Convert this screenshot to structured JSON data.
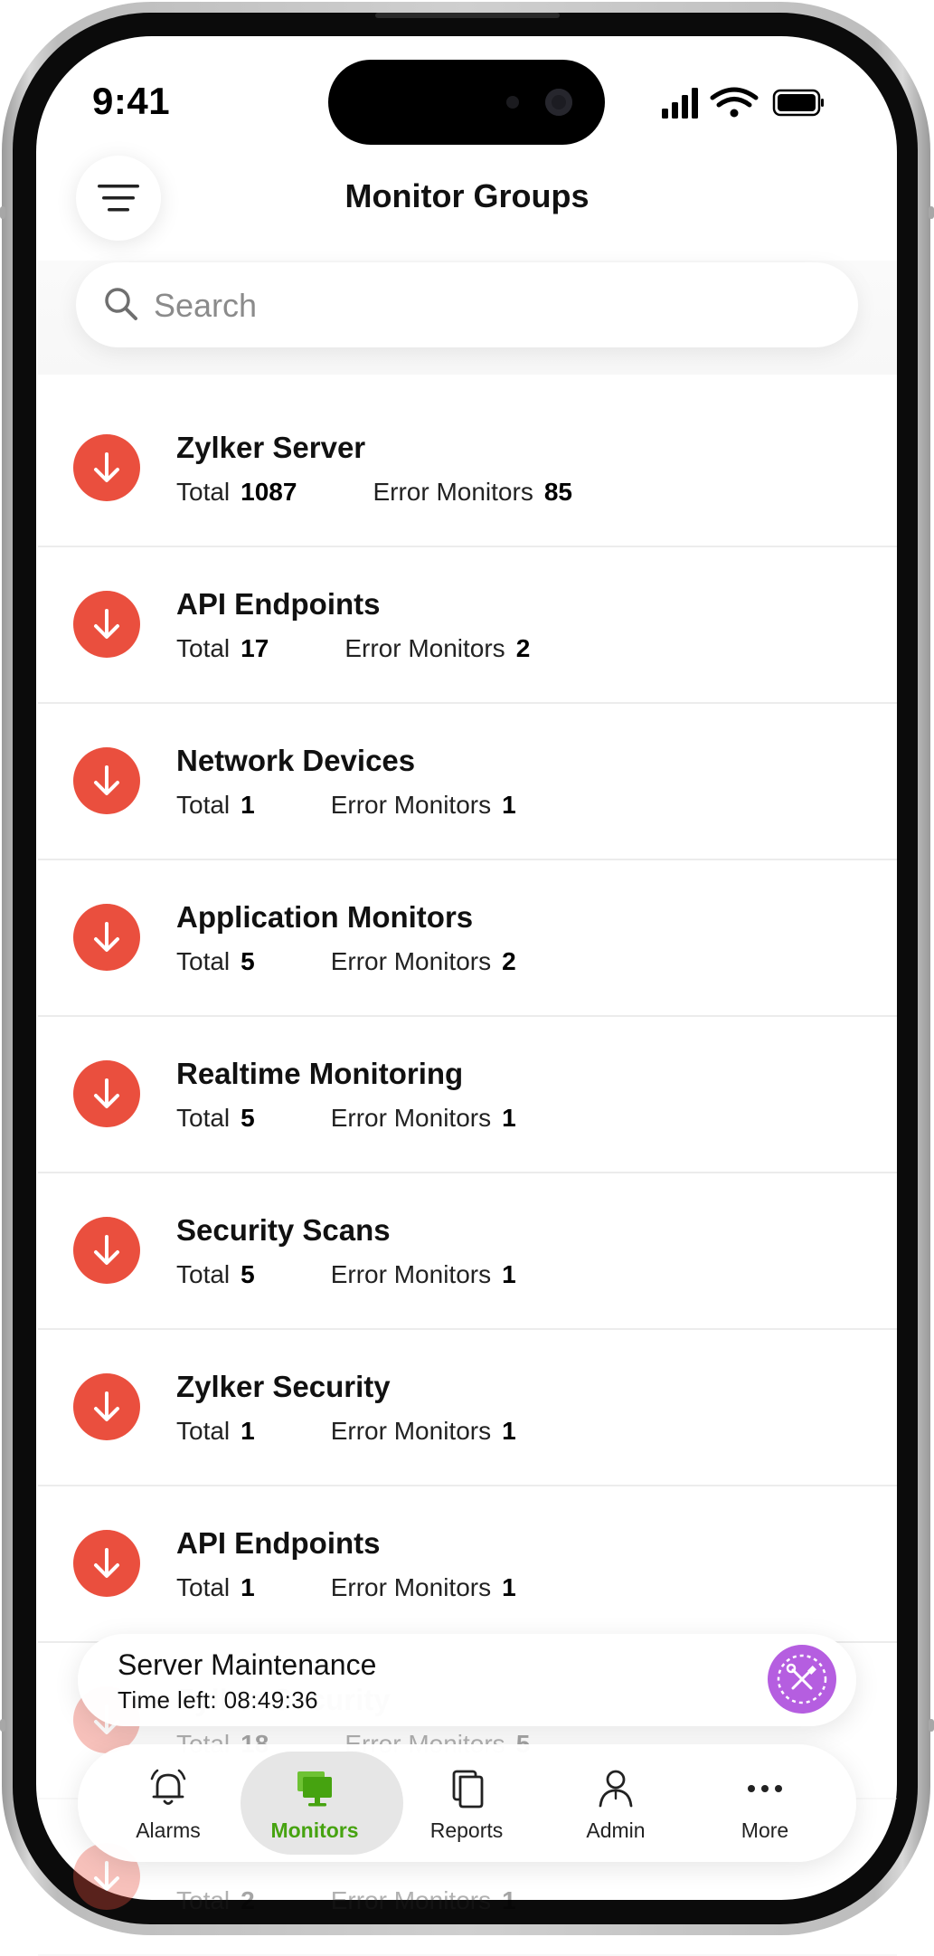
{
  "status_bar": {
    "time": "9:41"
  },
  "header": {
    "title": "Monitor Groups"
  },
  "search": {
    "placeholder": "Search"
  },
  "labels": {
    "total": "Total",
    "error_monitors": "Error Monitors"
  },
  "groups": [
    {
      "name": "Zylker Server",
      "total": "1087",
      "errors": "85"
    },
    {
      "name": "API Endpoints",
      "total": "17",
      "errors": "2"
    },
    {
      "name": "Network Devices",
      "total": "1",
      "errors": "1"
    },
    {
      "name": "Application Monitors",
      "total": "5",
      "errors": "2"
    },
    {
      "name": "Realtime Monitoring",
      "total": "5",
      "errors": "1"
    },
    {
      "name": "Security Scans",
      "total": "5",
      "errors": "1"
    },
    {
      "name": "Zylker Security",
      "total": "1",
      "errors": "1"
    },
    {
      "name": "API Endpoints",
      "total": "1",
      "errors": "1"
    },
    {
      "name": "Zylker Security",
      "total": "18",
      "errors": "5"
    },
    {
      "name": "",
      "total": "2",
      "errors": "1"
    }
  ],
  "maintenance": {
    "title": "Server Maintenance",
    "time_left": "Time left: 08:49:36"
  },
  "tabs": [
    {
      "label": "Alarms",
      "icon": "bell-icon"
    },
    {
      "label": "Monitors",
      "icon": "monitors-icon"
    },
    {
      "label": "Reports",
      "icon": "reports-icon"
    },
    {
      "label": "Admin",
      "icon": "admin-icon"
    },
    {
      "label": "More",
      "icon": "more-icon"
    }
  ],
  "colors": {
    "status_down": "#ea4f3e",
    "active_tab": "#46a310",
    "maintenance_button": "#b55ee0"
  }
}
